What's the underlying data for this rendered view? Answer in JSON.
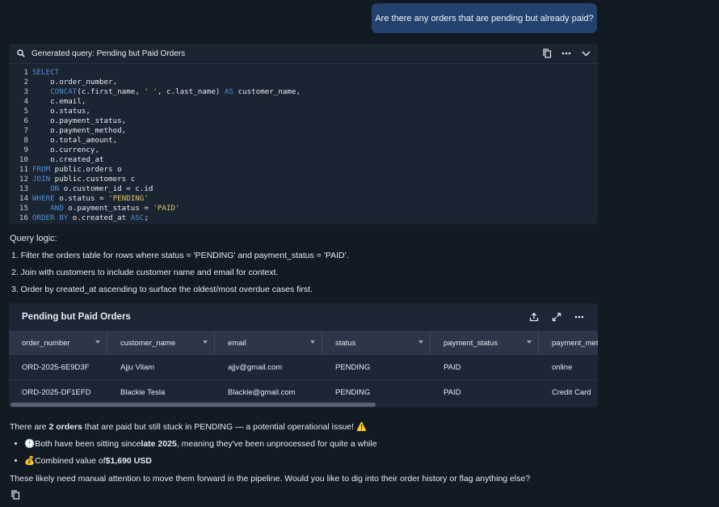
{
  "user_message": "Are there any orders that are pending but already paid?",
  "code_card": {
    "title": "Generated query: Pending but Paid Orders",
    "lines": [
      [
        {
          "t": "SELECT",
          "c": "kw"
        }
      ],
      [
        {
          "t": "    o.order_number,",
          "c": ""
        }
      ],
      [
        {
          "t": "    ",
          "c": ""
        },
        {
          "t": "CONCAT",
          "c": "kw"
        },
        {
          "t": "(c.first_name, ",
          "c": ""
        },
        {
          "t": "' '",
          "c": "str"
        },
        {
          "t": ", c.last_name) ",
          "c": ""
        },
        {
          "t": "AS",
          "c": "kw"
        },
        {
          "t": " customer_name,",
          "c": ""
        }
      ],
      [
        {
          "t": "    c.email,",
          "c": ""
        }
      ],
      [
        {
          "t": "    o.status,",
          "c": ""
        }
      ],
      [
        {
          "t": "    o.payment_status,",
          "c": ""
        }
      ],
      [
        {
          "t": "    o.payment_method,",
          "c": ""
        }
      ],
      [
        {
          "t": "    o.total_amount,",
          "c": ""
        }
      ],
      [
        {
          "t": "    o.currency,",
          "c": ""
        }
      ],
      [
        {
          "t": "    o.created_at",
          "c": ""
        }
      ],
      [
        {
          "t": "FROM",
          "c": "kw"
        },
        {
          "t": " public.orders o",
          "c": ""
        }
      ],
      [
        {
          "t": "JOIN",
          "c": "kw"
        },
        {
          "t": " public.customers c",
          "c": ""
        }
      ],
      [
        {
          "t": "    ",
          "c": ""
        },
        {
          "t": "ON",
          "c": "kw"
        },
        {
          "t": " o.customer_id = c.id",
          "c": ""
        }
      ],
      [
        {
          "t": "WHERE",
          "c": "kw"
        },
        {
          "t": " o.status = ",
          "c": ""
        },
        {
          "t": "'PENDING'",
          "c": "str"
        }
      ],
      [
        {
          "t": "    ",
          "c": ""
        },
        {
          "t": "AND",
          "c": "kw"
        },
        {
          "t": " o.payment_status = ",
          "c": ""
        },
        {
          "t": "'PAID'",
          "c": "str"
        }
      ],
      [
        {
          "t": "ORDER BY",
          "c": "kw"
        },
        {
          "t": " o.created_at ",
          "c": ""
        },
        {
          "t": "ASC",
          "c": "kw"
        },
        {
          "t": ";",
          "c": ""
        }
      ]
    ]
  },
  "query_logic": {
    "heading": "Query logic:",
    "items": [
      "1. Filter the orders table for rows where status = 'PENDING' and payment_status = 'PAID'.",
      "2. Join with customers to include customer name and email for context.",
      "3. Order by created_at ascending to surface the oldest/most overdue cases first."
    ]
  },
  "result_table": {
    "title": "Pending but Paid Orders",
    "columns": [
      "order_number",
      "customer_name",
      "email",
      "status",
      "payment_status",
      "payment_met"
    ],
    "rows": [
      [
        "ORD-2025-6E9D3F",
        "Ajju Vilam",
        "ajjv@gmail.com",
        "PENDING",
        "PAID",
        "online"
      ],
      [
        "ORD-2025-DF1EFD",
        "Blackie Tesla",
        "Blackie@gmail.com",
        "PENDING",
        "PAID",
        "Credit Card"
      ]
    ],
    "horizontal_scroll_fraction": 0.62
  },
  "summary": {
    "pre": "There are ",
    "count": "2 orders",
    "post": " that are paid but still stuck in PENDING — a potential operational issue! ⚠️"
  },
  "bullets": [
    {
      "icon": "🕐",
      "pre": " Both have been sitting since ",
      "bold": "late 2025",
      "post": ", meaning they've been unprocessed for quite a while"
    },
    {
      "icon": "💰",
      "pre": " Combined value of ",
      "bold": "$1,690 USD",
      "post": ""
    }
  ],
  "closing": "These likely need manual attention to move them forward in the pipeline. Would you like to dig into their order history or flag anything else?",
  "colors": {
    "user_bubble": "#23436e",
    "background": "#121a24",
    "keyword": "#4f8fd9",
    "string": "#e0c469"
  }
}
